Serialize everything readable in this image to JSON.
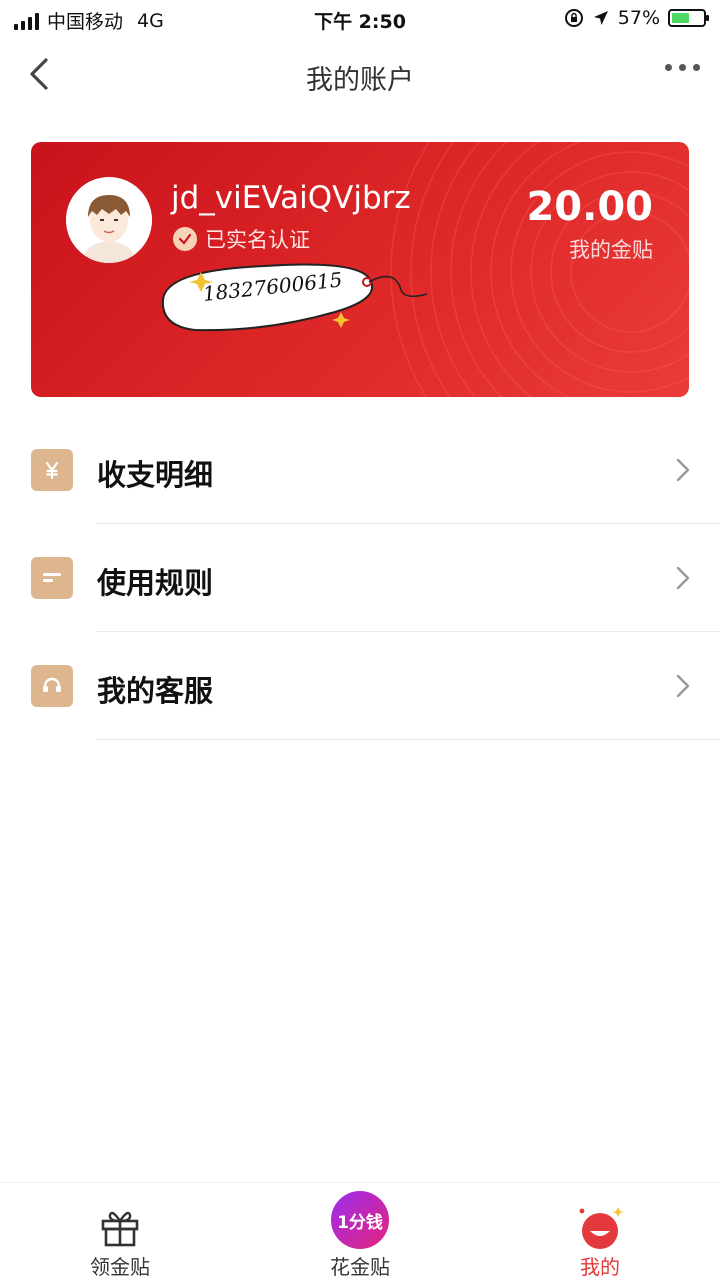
{
  "status_bar": {
    "carrier": "中国移动",
    "network": "4G",
    "time": "下午 2:50",
    "battery": "57%",
    "battery_level": 0.57
  },
  "nav": {
    "title": "我的账户",
    "back_icon": "chevron-left-icon",
    "more_icon": "more-dots-icon"
  },
  "account_card": {
    "username": "jd_viEVaiQVjbrz",
    "verified_text": "已实名认证",
    "phone": "18327600615",
    "balance": "20.00",
    "balance_label": "我的金贴",
    "background_color": "#d81e24"
  },
  "menu": {
    "items": [
      {
        "label": "收支明细",
        "icon": "yuan-icon"
      },
      {
        "label": "使用规则",
        "icon": "document-icon"
      },
      {
        "label": "我的客服",
        "icon": "headset-icon"
      }
    ]
  },
  "tab_bar": {
    "tabs": [
      {
        "label": "领金贴",
        "icon": "gift-icon",
        "active": false
      },
      {
        "label": "花金贴",
        "icon": "one-cent-badge-icon",
        "badge_text": "1分钱",
        "active": false
      },
      {
        "label": "我的",
        "icon": "profile-face-icon",
        "active": true
      }
    ],
    "accent_color": "#e4393c"
  }
}
